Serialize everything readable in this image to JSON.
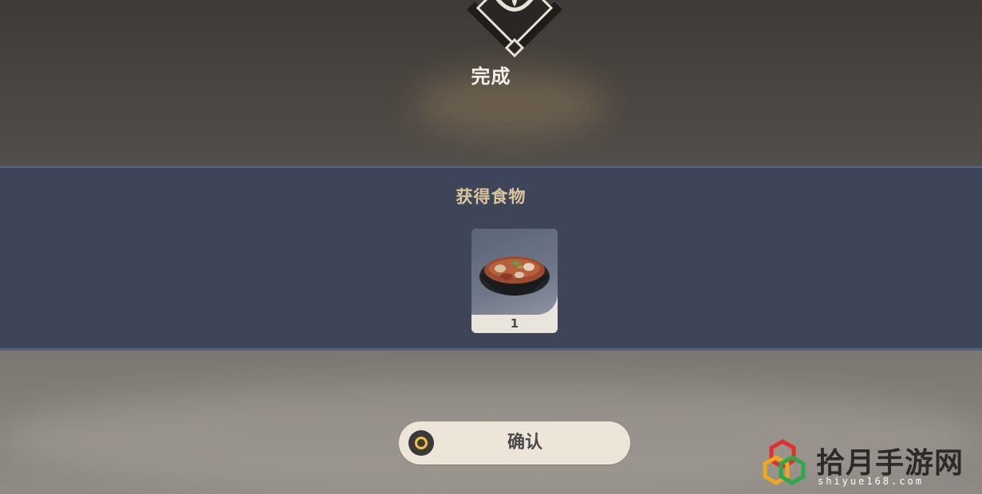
{
  "header": {
    "status_label": "完成"
  },
  "reward": {
    "title": "获得食物",
    "item": {
      "icon": "soup-bowl-icon",
      "count": "1"
    }
  },
  "actions": {
    "confirm_label": "确认",
    "confirm_icon": "controller-circle-button-icon"
  },
  "watermark": {
    "name": "拾月手游网",
    "url": "shiyue168.com"
  },
  "colors": {
    "panel": "#3e4559",
    "title_gold": "#d9c59a",
    "button": "#ece5d8",
    "button_ring": "#f2c23a"
  }
}
